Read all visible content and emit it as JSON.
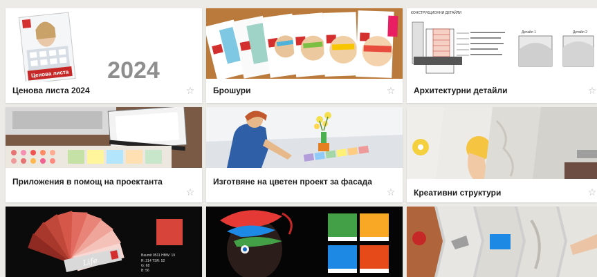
{
  "section": {
    "title": ""
  },
  "cards": [
    {
      "title": "Ценова листа 2024",
      "cover_title": "Ценова листа",
      "big_year": "2024"
    },
    {
      "title": "Брошури"
    },
    {
      "title": "Архитектурни детайли",
      "sheet_heading": "КОНСТРУКЦИОННИ ДЕТАЙЛИ",
      "detail_1": "Детайл 1",
      "detail_2": "Детайл 2"
    },
    {
      "title": "Приложения в помощ на проектанта"
    },
    {
      "title": "Изготвяне на цветен проект за фасада"
    },
    {
      "title": "Креативни структури"
    },
    {
      "title": "",
      "swatch_info_1": "Baumit 0511   HBW: 19",
      "swatch_info_2": "R: 214   TSR: 52",
      "swatch_info_3": "G: 68",
      "swatch_info_4": "B: 56",
      "fan_label": "Life"
    },
    {
      "title": ""
    },
    {
      "title": ""
    }
  ],
  "icons": {
    "star": "☆",
    "favorite_icon_name": "star-outline-icon"
  },
  "colors": {
    "accent_red": "#d32f2f",
    "page_bg": "#ecebe8"
  }
}
